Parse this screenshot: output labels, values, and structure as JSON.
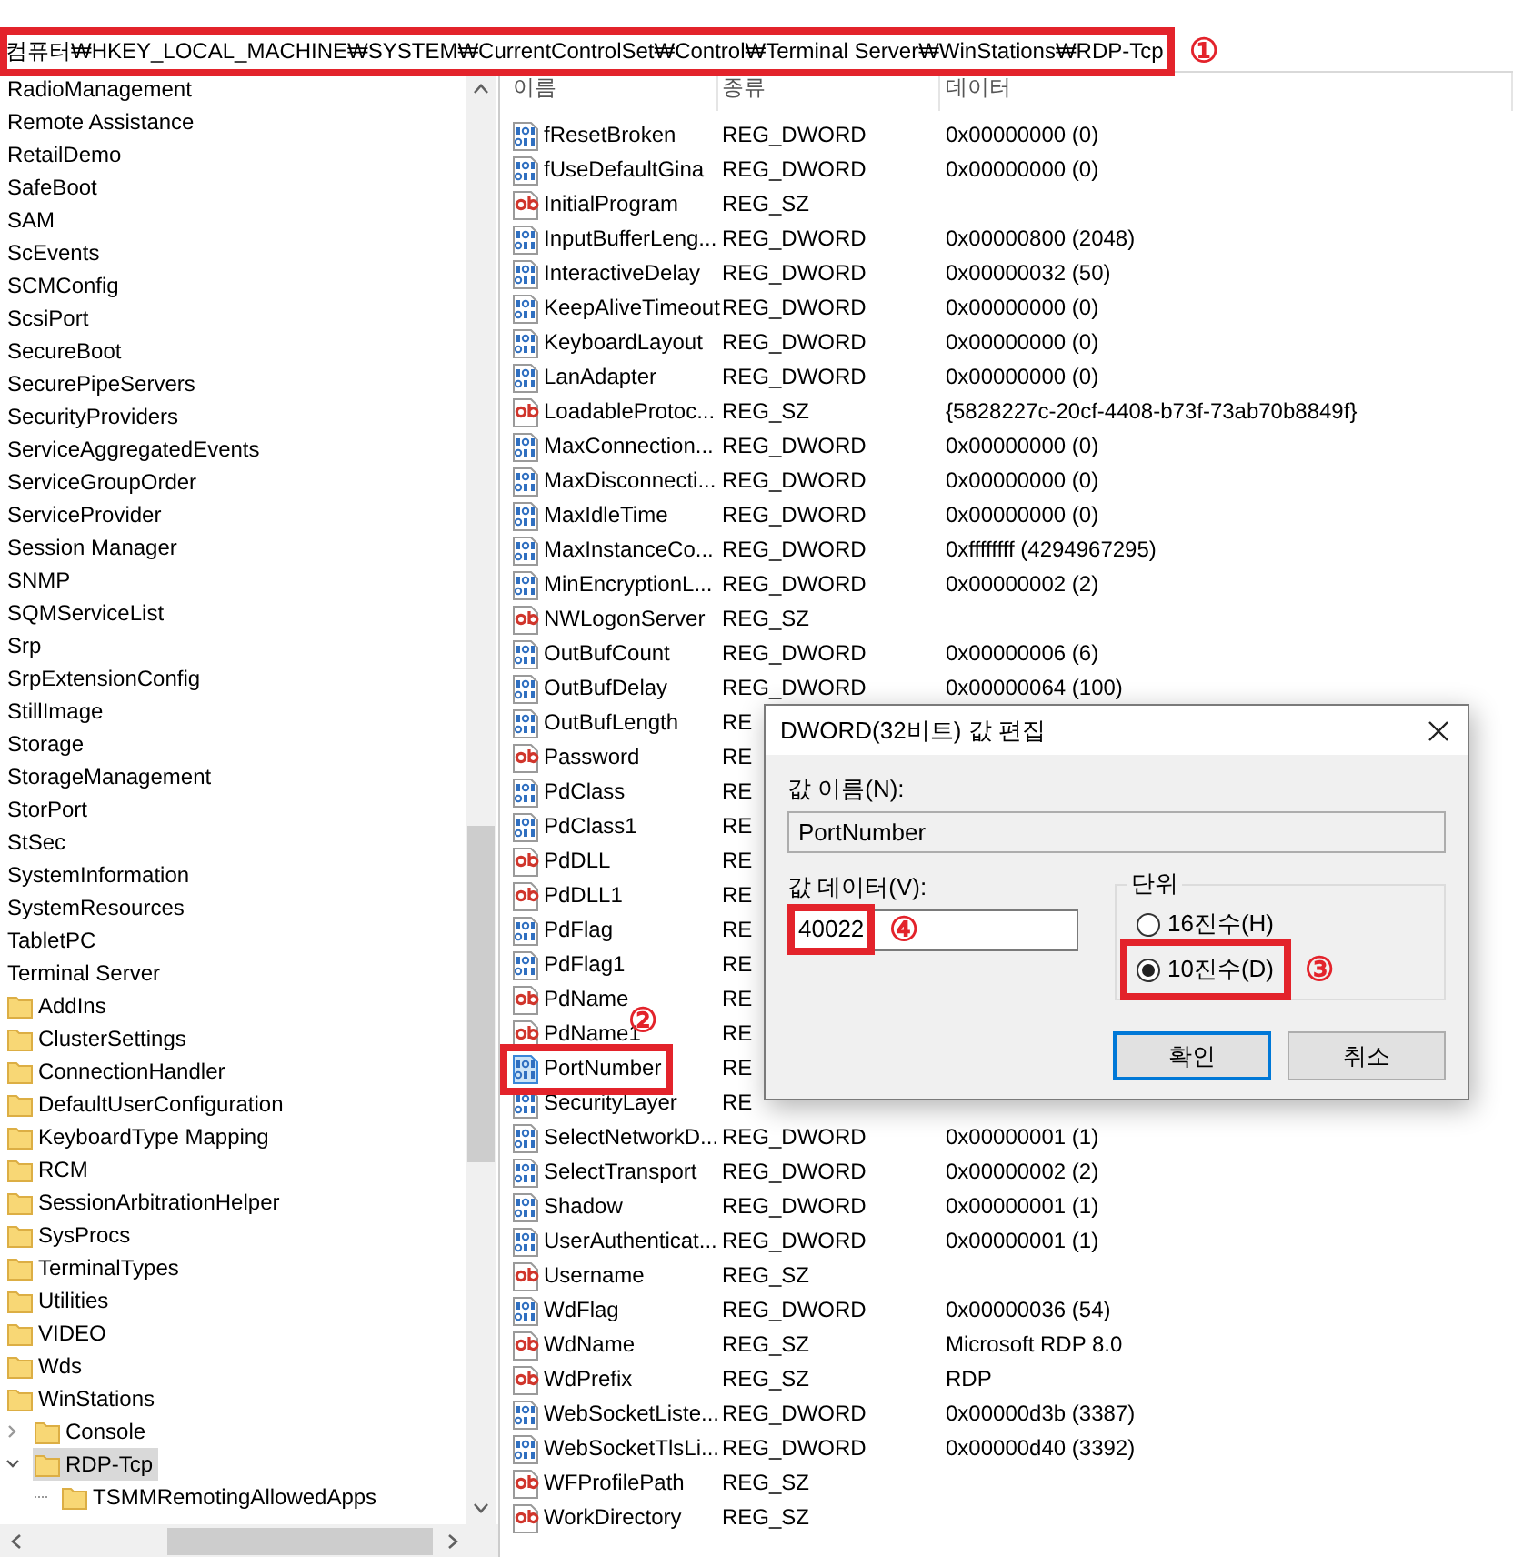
{
  "address_bar": {
    "path": "컴퓨터₩HKEY_LOCAL_MACHINE₩SYSTEM₩CurrentControlSet₩Control₩Terminal Server₩WinStations₩RDP-Tcp",
    "annotation": "①"
  },
  "tree": {
    "items": [
      {
        "label": "RadioManagement",
        "selected": false
      },
      {
        "label": "Remote Assistance",
        "selected": false
      },
      {
        "label": "RetailDemo",
        "selected": false
      },
      {
        "label": "SafeBoot",
        "selected": false
      },
      {
        "label": "SAM",
        "selected": false
      },
      {
        "label": "ScEvents",
        "selected": false
      },
      {
        "label": "SCMConfig",
        "selected": false
      },
      {
        "label": "ScsiPort",
        "selected": false
      },
      {
        "label": "SecureBoot",
        "selected": false
      },
      {
        "label": "SecurePipeServers",
        "selected": false
      },
      {
        "label": "SecurityProviders",
        "selected": false
      },
      {
        "label": "ServiceAggregatedEvents",
        "selected": false
      },
      {
        "label": "ServiceGroupOrder",
        "selected": false
      },
      {
        "label": "ServiceProvider",
        "selected": false
      },
      {
        "label": "Session Manager",
        "selected": false
      },
      {
        "label": "SNMP",
        "selected": false
      },
      {
        "label": "SQMServiceList",
        "selected": false
      },
      {
        "label": "Srp",
        "selected": false
      },
      {
        "label": "SrpExtensionConfig",
        "selected": false
      },
      {
        "label": "StillImage",
        "selected": false
      },
      {
        "label": "Storage",
        "selected": false
      },
      {
        "label": "StorageManagement",
        "selected": false
      },
      {
        "label": "StorPort",
        "selected": false
      },
      {
        "label": "StSec",
        "selected": false
      },
      {
        "label": "SystemInformation",
        "selected": false
      },
      {
        "label": "SystemResources",
        "selected": false
      },
      {
        "label": "TabletPC",
        "selected": false
      },
      {
        "label": "Terminal Server",
        "selected": false,
        "children": [
          {
            "label": "AddIns",
            "selected": false
          },
          {
            "label": "ClusterSettings",
            "selected": false
          },
          {
            "label": "ConnectionHandler",
            "selected": false
          },
          {
            "label": "DefaultUserConfiguration",
            "selected": false
          },
          {
            "label": "KeyboardType Mapping",
            "selected": false
          },
          {
            "label": "RCM",
            "selected": false
          },
          {
            "label": "SessionArbitrationHelper",
            "selected": false
          },
          {
            "label": "SysProcs",
            "selected": false
          },
          {
            "label": "TerminalTypes",
            "selected": false
          },
          {
            "label": "Utilities",
            "selected": false
          },
          {
            "label": "VIDEO",
            "selected": false
          },
          {
            "label": "Wds",
            "selected": false
          },
          {
            "label": "WinStations",
            "selected": false,
            "children": [
              {
                "label": "Console",
                "selected": false,
                "expanded": false
              },
              {
                "label": "RDP-Tcp",
                "selected": true,
                "expanded": true,
                "children": [
                  {
                    "label": "TSMMRemotingAllowedApps",
                    "selected": false
                  }
                ]
              }
            ]
          }
        ]
      }
    ]
  },
  "values": {
    "columns": [
      "이름",
      "종류",
      "데이터"
    ],
    "rows": [
      {
        "name": "fResetBroken",
        "type": "REG_DWORD",
        "data": "0x00000000 (0)",
        "kind": "dword",
        "selected": false
      },
      {
        "name": "fUseDefaultGina",
        "type": "REG_DWORD",
        "data": "0x00000000 (0)",
        "kind": "dword",
        "selected": false
      },
      {
        "name": "InitialProgram",
        "type": "REG_SZ",
        "kind": "string",
        "selected": false
      },
      {
        "name": "InputBufferLeng...",
        "type": "REG_DWORD",
        "data": "0x00000800 (2048)",
        "kind": "dword",
        "selected": false
      },
      {
        "name": "InteractiveDelay",
        "type": "REG_DWORD",
        "data": "0x00000032 (50)",
        "kind": "dword",
        "selected": false
      },
      {
        "name": "KeepAliveTimeout",
        "type": "REG_DWORD",
        "data": "0x00000000 (0)",
        "kind": "dword",
        "selected": false
      },
      {
        "name": "KeyboardLayout",
        "type": "REG_DWORD",
        "data": "0x00000000 (0)",
        "kind": "dword",
        "selected": false
      },
      {
        "name": "LanAdapter",
        "type": "REG_DWORD",
        "data": "0x00000000 (0)",
        "kind": "dword",
        "selected": false
      },
      {
        "name": "LoadableProtoc...",
        "type": "REG_SZ",
        "data": "{5828227c-20cf-4408-b73f-73ab70b8849f}",
        "kind": "string",
        "selected": false
      },
      {
        "name": "MaxConnection...",
        "type": "REG_DWORD",
        "data": "0x00000000 (0)",
        "kind": "dword",
        "selected": false
      },
      {
        "name": "MaxDisconnecti...",
        "type": "REG_DWORD",
        "data": "0x00000000 (0)",
        "kind": "dword",
        "selected": false
      },
      {
        "name": "MaxIdleTime",
        "type": "REG_DWORD",
        "data": "0x00000000 (0)",
        "kind": "dword",
        "selected": false
      },
      {
        "name": "MaxInstanceCo...",
        "type": "REG_DWORD",
        "data": "0xffffffff (4294967295)",
        "kind": "dword",
        "selected": false
      },
      {
        "name": "MinEncryptionL...",
        "type": "REG_DWORD",
        "data": "0x00000002 (2)",
        "kind": "dword",
        "selected": false
      },
      {
        "name": "NWLogonServer",
        "type": "REG_SZ",
        "kind": "string",
        "selected": false
      },
      {
        "name": "OutBufCount",
        "type": "REG_DWORD",
        "data": "0x00000006 (6)",
        "kind": "dword",
        "selected": false
      },
      {
        "name": "OutBufDelay",
        "type": "REG_DWORD",
        "data": "0x00000064 (100)",
        "kind": "dword",
        "selected": false
      },
      {
        "name": "OutBufLength",
        "type": "RE",
        "kind": "dword",
        "selected": false
      },
      {
        "name": "Password",
        "type": "RE",
        "kind": "string",
        "selected": false
      },
      {
        "name": "PdClass",
        "type": "RE",
        "kind": "dword",
        "selected": false
      },
      {
        "name": "PdClass1",
        "type": "RE",
        "kind": "dword",
        "selected": false
      },
      {
        "name": "PdDLL",
        "type": "RE",
        "kind": "string",
        "selected": false
      },
      {
        "name": "PdDLL1",
        "type": "RE",
        "kind": "string",
        "selected": false
      },
      {
        "name": "PdFlag",
        "type": "RE",
        "kind": "dword",
        "selected": false
      },
      {
        "name": "PdFlag1",
        "type": "RE",
        "kind": "dword",
        "selected": false
      },
      {
        "name": "PdName",
        "type": "RE",
        "kind": "string",
        "selected": false
      },
      {
        "name": "PdName1",
        "type": "RE",
        "kind": "string",
        "selected": false
      },
      {
        "name": "PortNumber",
        "type": "RE",
        "kind": "dword",
        "selected": true,
        "annotation": "②"
      },
      {
        "name": "SecurityLayer",
        "type": "RE",
        "kind": "dword",
        "selected": false
      },
      {
        "name": "SelectNetworkD...",
        "type": "REG_DWORD",
        "data": "0x00000001 (1)",
        "kind": "dword",
        "selected": false
      },
      {
        "name": "SelectTransport",
        "type": "REG_DWORD",
        "data": "0x00000002 (2)",
        "kind": "dword",
        "selected": false
      },
      {
        "name": "Shadow",
        "type": "REG_DWORD",
        "data": "0x00000001 (1)",
        "kind": "dword",
        "selected": false
      },
      {
        "name": "UserAuthenticat...",
        "type": "REG_DWORD",
        "data": "0x00000001 (1)",
        "kind": "dword",
        "selected": false
      },
      {
        "name": "Username",
        "type": "REG_SZ",
        "kind": "string",
        "selected": false
      },
      {
        "name": "WdFlag",
        "type": "REG_DWORD",
        "data": "0x00000036 (54)",
        "kind": "dword",
        "selected": false
      },
      {
        "name": "WdName",
        "type": "REG_SZ",
        "data": "Microsoft RDP 8.0",
        "kind": "string",
        "selected": false
      },
      {
        "name": "WdPrefix",
        "type": "REG_SZ",
        "data": "RDP",
        "kind": "string",
        "selected": false
      },
      {
        "name": "WebSocketListe...",
        "type": "REG_DWORD",
        "data": "0x00000d3b (3387)",
        "kind": "dword",
        "selected": false
      },
      {
        "name": "WebSocketTlsLi...",
        "type": "REG_DWORD",
        "data": "0x00000d40 (3392)",
        "kind": "dword",
        "selected": false
      },
      {
        "name": "WFProfilePath",
        "type": "REG_SZ",
        "kind": "string",
        "selected": false
      },
      {
        "name": "WorkDirectory",
        "type": "REG_SZ",
        "kind": "string",
        "selected": false
      }
    ]
  },
  "dialog": {
    "title": "DWORD(32비트) 값 편집",
    "name_label": "값 이름(N):",
    "name_value": "PortNumber",
    "data_label": "값 데이터(V):",
    "data_value": "40022",
    "data_annotation": "④",
    "radix": {
      "label": "단위",
      "options": [
        {
          "label": "16진수(H)",
          "selected": false
        },
        {
          "label": "10진수(D)",
          "selected": true,
          "annotation": "③"
        }
      ]
    },
    "buttons": [
      {
        "label": "확인",
        "default": true
      },
      {
        "label": "취소",
        "default": false
      }
    ]
  }
}
